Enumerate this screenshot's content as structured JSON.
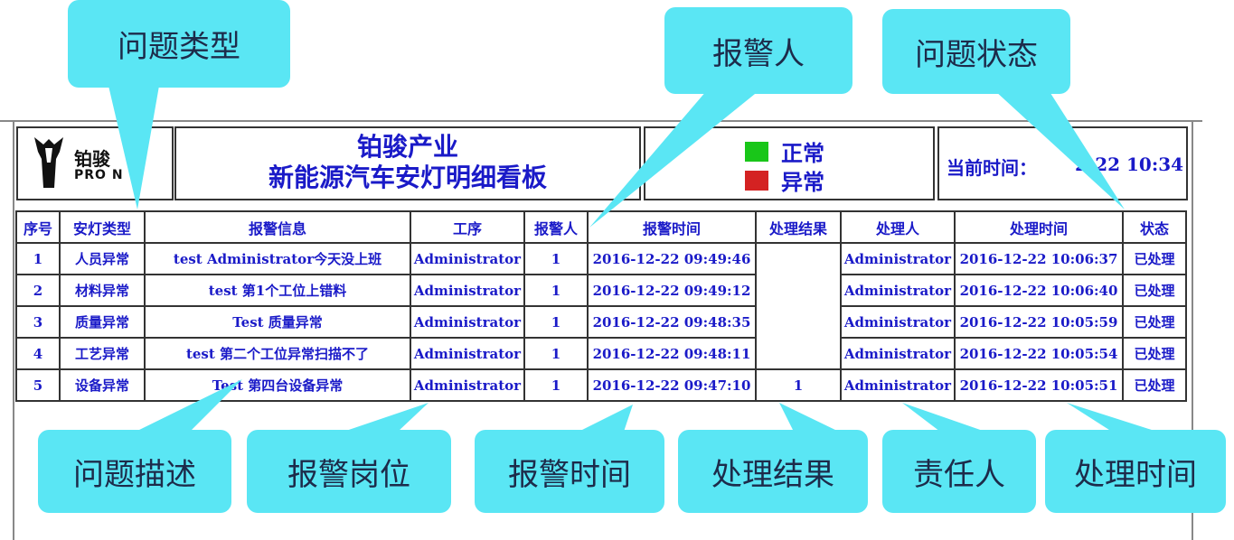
{
  "header": {
    "logo_cn": "铂骏",
    "logo_en": "PRO  N",
    "title_line1": "铂骏产业",
    "title_line2": "新能源汽车安灯明细看板",
    "legend": [
      {
        "label": "正常",
        "color": "#19c619"
      },
      {
        "label": "异常",
        "color": "#d42222"
      }
    ],
    "time_label": "当前时间：",
    "time_value": "2-22 10:34"
  },
  "table": {
    "columns": [
      "序号",
      "安灯类型",
      "报警信息",
      "工序",
      "报警人",
      "报警时间",
      "处理结果",
      "处理人",
      "处理时间",
      "状态"
    ],
    "rows": [
      {
        "no": "1",
        "type": "人员异常",
        "info": "test Administrator今天没上班",
        "station": "Administrator",
        "reporter": "1",
        "alarm_time": "2016-12-22 09:49:46",
        "result": "",
        "handler": "Administrator",
        "handle_time": "2016-12-22 10:06:37",
        "status": "已处理"
      },
      {
        "no": "2",
        "type": "材料异常",
        "info": "test 第1个工位上错料",
        "station": "Administrator",
        "reporter": "1",
        "alarm_time": "2016-12-22 09:49:12",
        "result": "",
        "handler": "Administrator",
        "handle_time": "2016-12-22 10:06:40",
        "status": "已处理"
      },
      {
        "no": "3",
        "type": "质量异常",
        "info": "Test 质量异常",
        "station": "Administrator",
        "reporter": "1",
        "alarm_time": "2016-12-22 09:48:35",
        "result": "",
        "handler": "Administrator",
        "handle_time": "2016-12-22 10:05:59",
        "status": "已处理"
      },
      {
        "no": "4",
        "type": "工艺异常",
        "info": "test 第二个工位异常扫描不了",
        "station": "Administrator",
        "reporter": "1",
        "alarm_time": "2016-12-22 09:48:11",
        "result": "",
        "handler": "Administrator",
        "handle_time": "2016-12-22 10:05:54",
        "status": "已处理"
      },
      {
        "no": "5",
        "type": "设备异常",
        "info": "Test 第四台设备异常",
        "station": "Administrator",
        "reporter": "1",
        "alarm_time": "2016-12-22 09:47:10",
        "result": "1",
        "handler": "Administrator",
        "handle_time": "2016-12-22 10:05:51",
        "status": "已处理"
      }
    ]
  },
  "callouts": {
    "problem_type": "问题类型",
    "reporter": "报警人",
    "problem_status": "问题状态",
    "problem_desc": "问题描述",
    "alarm_post": "报警岗位",
    "alarm_time": "报警时间",
    "handle_result": "处理结果",
    "responsible": "责任人",
    "handle_time": "处理时间"
  }
}
